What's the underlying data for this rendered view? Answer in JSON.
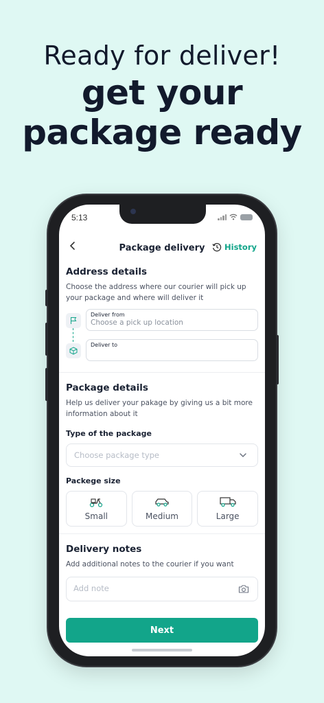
{
  "hero": {
    "line1": "Ready for deliver!",
    "line2a": "get your",
    "line2b": "package ready"
  },
  "status_bar": {
    "time": "5:13"
  },
  "nav": {
    "title": "Package delivery",
    "history_label": "History"
  },
  "address": {
    "title": "Address details",
    "description": "Choose the address where our courier will pick up your package and where will deliver it",
    "from_label": "Deliver from",
    "from_placeholder": "Choose a pick up location",
    "to_label": "Deliver to",
    "to_value": ""
  },
  "package": {
    "title": "Package details",
    "description": "Help us deliver your pakage by giving us a bit more information about it",
    "type_label": "Type of  the package",
    "type_placeholder": "Choose package type",
    "size_label": "Packege size",
    "sizes": [
      {
        "label": "Small",
        "icon": "scooter-icon"
      },
      {
        "label": "Medium",
        "icon": "car-icon"
      },
      {
        "label": "Large",
        "icon": "truck-icon"
      }
    ]
  },
  "notes": {
    "title": "Delivery notes",
    "description": "Add additional notes to the courier if you want",
    "placeholder": "Add note"
  },
  "actions": {
    "next_label": "Next"
  },
  "colors": {
    "accent": "#12a58a",
    "background": "#dff8f3",
    "text": "#1a2233"
  }
}
